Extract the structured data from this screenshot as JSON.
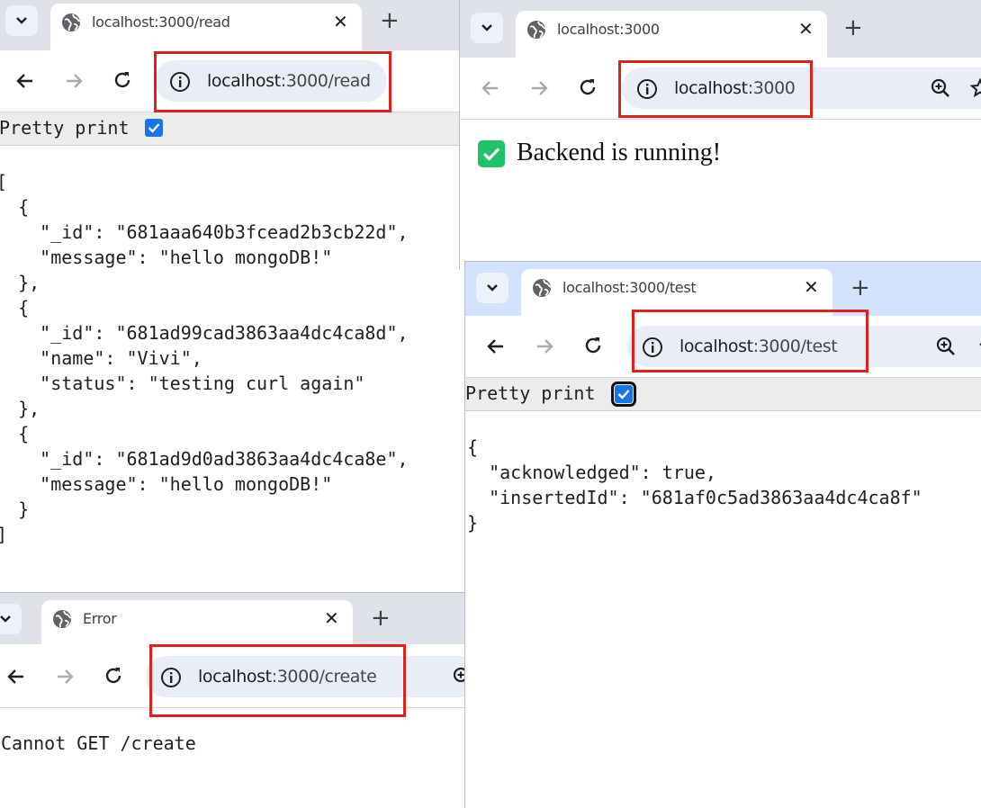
{
  "win_read": {
    "tab_title": "localhost:3000/read",
    "url_host": "localhost",
    "url_path": ":3000/read",
    "pretty_print_label": "Pretty print",
    "pretty_print_checked": true,
    "json_lines": [
      "[",
      "  {",
      "    \"_id\": \"681aaa640b3fcead2b3cb22d\",",
      "    \"message\": \"hello mongoDB!\"",
      "  },",
      "  {",
      "    \"_id\": \"681ad99cad3863aa4dc4ca8d\",",
      "    \"name\": \"Vivi\",",
      "    \"status\": \"testing curl again\"",
      "  },",
      "  {",
      "    \"_id\": \"681ad9d0ad3863aa4dc4ca8e\",",
      "    \"message\": \"hello mongoDB!\"",
      "  }",
      "]"
    ]
  },
  "win_root": {
    "tab_title": "localhost:3000",
    "url_host": "localhost",
    "url_path": ":3000",
    "status_text": "Backend is running!",
    "status_emoji_color": "#21c16b"
  },
  "win_test": {
    "tab_title": "localhost:3000/test",
    "url_host": "localhost",
    "url_path": ":3000/test",
    "pretty_print_label": "Pretty print",
    "pretty_print_checked": true,
    "json_lines": [
      "{",
      "  \"acknowledged\": true,",
      "  \"insertedId\": \"681af0c5ad3863aa4dc4ca8f\"",
      "}"
    ]
  },
  "win_create": {
    "tab_title": "Error",
    "url_host": "localhost",
    "url_path": ":3000/create",
    "body_text": "Cannot GET /create"
  },
  "icons": {
    "dropdown": "chevron-down-icon",
    "globe": "globe-icon",
    "close": "close-icon",
    "new_tab": "plus-icon",
    "back": "arrow-left-icon",
    "forward": "arrow-right-icon",
    "reload": "reload-icon",
    "site_info": "info-icon",
    "zoom": "zoom-in-icon",
    "bookmark": "star-icon"
  },
  "colors": {
    "highlight_box": "#e0201e",
    "checkbox": "#1a73e8",
    "tab_strip": "#dfe3e9",
    "omnibox": "#e9eef6"
  },
  "symbols": {
    "close": "✕",
    "new_tab": "+",
    "check": "✓"
  }
}
